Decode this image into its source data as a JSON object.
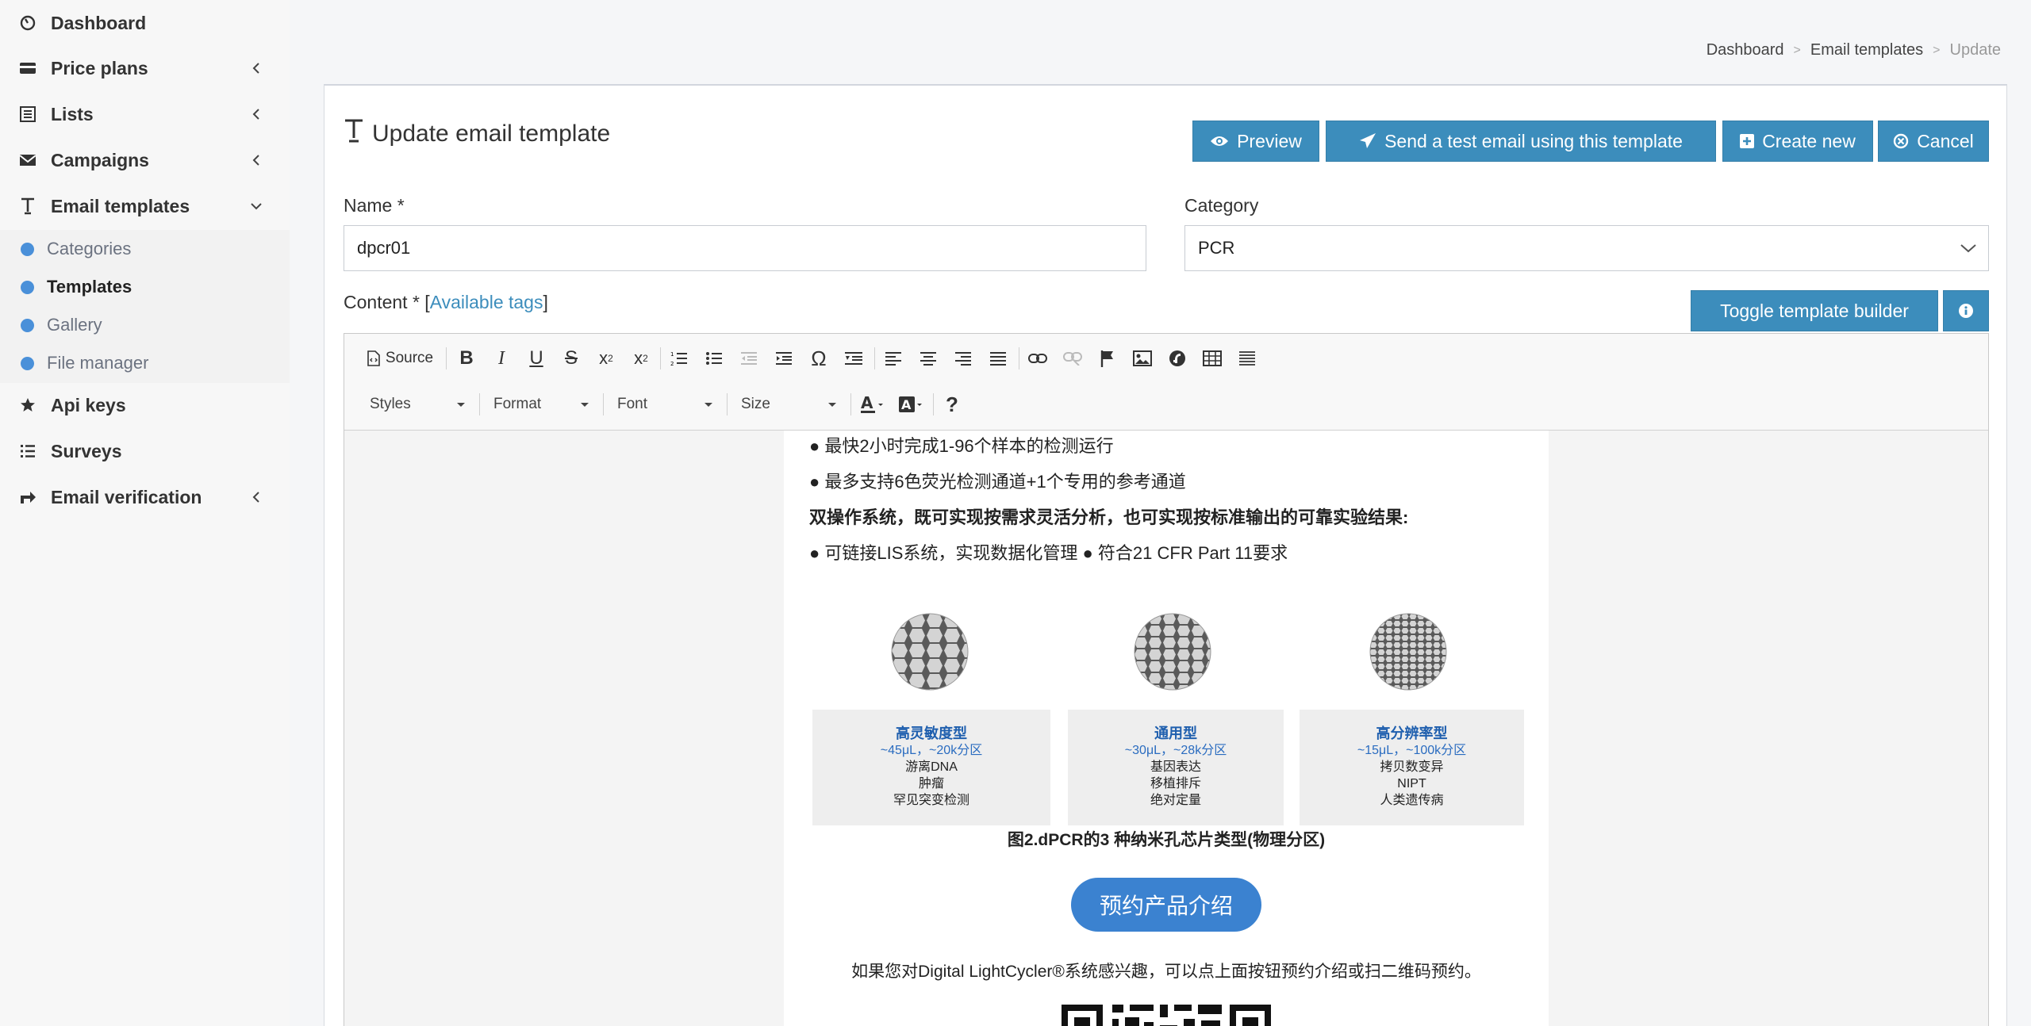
{
  "sidebar": {
    "items": [
      {
        "label": "Dashboard"
      },
      {
        "label": "Price plans"
      },
      {
        "label": "Lists"
      },
      {
        "label": "Campaigns"
      },
      {
        "label": "Email templates"
      },
      {
        "label": "Api keys"
      },
      {
        "label": "Surveys"
      },
      {
        "label": "Email verification"
      }
    ],
    "subitems": [
      {
        "label": "Categories"
      },
      {
        "label": "Templates"
      },
      {
        "label": "Gallery"
      },
      {
        "label": "File manager"
      }
    ]
  },
  "breadcrumb": {
    "items": [
      "Dashboard",
      "Email templates"
    ],
    "current": "Update",
    "separator": ">"
  },
  "panel": {
    "title": "Update email template",
    "buttons": {
      "preview": "Preview",
      "send_test": "Send a test email using this template",
      "create_new": "Create new",
      "cancel": "Cancel",
      "toggle_builder": "Toggle template builder"
    },
    "name_label": "Name *",
    "name_value": "dpcr01",
    "category_label": "Category",
    "category_value": "PCR",
    "content_label": "Content *",
    "available_tags_open": "[",
    "available_tags": "Available tags",
    "available_tags_close": "]"
  },
  "editor": {
    "source_label": "Source",
    "combos": [
      "Styles",
      "Format",
      "Font",
      "Size"
    ],
    "help": "?"
  },
  "email": {
    "lines": [
      "● 最快2小时完成1-96个样本的检测运行",
      "● 最多支持6色荧光检测通道+1个专用的参考通道",
      "双操作系统，既可实现按需求灵活分析，也可实现按标准输出的可靠实验结果:",
      "● 可链接LIS系统，实现数据化管理 ● 符合21 CFR Part 11要求"
    ],
    "cards": [
      {
        "title": "高灵敏度型",
        "spec": "~45μL，~20k分区",
        "uses": [
          "游离DNA",
          "肿瘤",
          "罕见突变检测"
        ]
      },
      {
        "title": "通用型",
        "spec": "~30μL，~28k分区",
        "uses": [
          "基因表达",
          "移植排斥",
          "绝对定量"
        ]
      },
      {
        "title": "高分辨率型",
        "spec": "~15μL，~100k分区",
        "uses": [
          "拷贝数变异",
          "NIPT",
          "人类遗传病"
        ]
      }
    ],
    "caption": "图2.dPCR的3 种纳米孔芯片类型(物理分区)",
    "cta": "预约产品介绍",
    "paragraph": "如果您对Digital LightCycler®系统感兴趣，可以点上面按钮预约介绍或扫二维码预约。"
  },
  "colors": {
    "primary": "#3c8dbc",
    "dot": "#4a90d9",
    "cta": "#3b82d0",
    "card_title": "#1f5fae"
  }
}
